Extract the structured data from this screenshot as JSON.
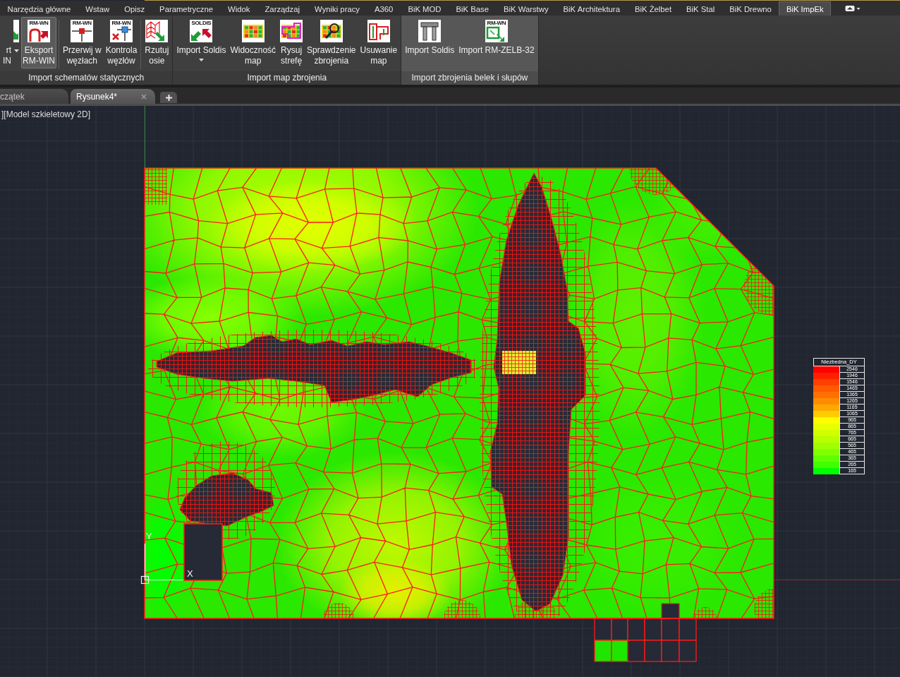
{
  "menu_tabs": [
    {
      "label": "Narzędzia główne",
      "selected": false
    },
    {
      "label": "Wstaw",
      "selected": false
    },
    {
      "label": "Opisz",
      "selected": false
    },
    {
      "label": "Parametryczne",
      "selected": false
    },
    {
      "label": "Widok",
      "selected": false
    },
    {
      "label": "Zarządzaj",
      "selected": false
    },
    {
      "label": "Wyniki pracy",
      "selected": false
    },
    {
      "label": "A360",
      "selected": false
    },
    {
      "label": "BiK MOD",
      "selected": false
    },
    {
      "label": "BiK Base",
      "selected": false
    },
    {
      "label": "BiK Warstwy",
      "selected": false
    },
    {
      "label": "BiK Architektura",
      "selected": false
    },
    {
      "label": "BiK Żelbet",
      "selected": false
    },
    {
      "label": "BiK Stal",
      "selected": false
    },
    {
      "label": "BiK Drewno",
      "selected": false
    },
    {
      "label": "BiK ImpEk",
      "selected": true
    }
  ],
  "ribbon_panels": [
    {
      "title": "Import schematów statycznych",
      "highlighted": false,
      "groups": [
        [
          {
            "label": "rt\nIN",
            "dropdown": true,
            "highlighted": false
          },
          {
            "label": "Eksport\nRM-WIN",
            "icon_text": "RM-WN",
            "dropdown": false,
            "highlighted": true
          }
        ],
        [
          {
            "label": "Przerwij w\nwęzłach",
            "icon_text": "RM-WN",
            "dropdown": false,
            "highlighted": false
          },
          {
            "label": "Kontrola\nwęzłów",
            "icon_text": "RM-WN",
            "dropdown": false,
            "highlighted": false
          }
        ],
        [
          {
            "label": "Rzutuj\nosie",
            "dropdown": false,
            "highlighted": false
          }
        ]
      ]
    },
    {
      "title": "Import map zbrojenia",
      "highlighted": false,
      "groups": [
        [
          {
            "label": "Import Soldis",
            "icon_text": "SOLDIS",
            "dropdown": true,
            "highlighted": false
          },
          {
            "label": "Widoczność\nmap",
            "dropdown": false,
            "highlighted": false
          },
          {
            "label": "Rysuj\nstrefę",
            "dropdown": false,
            "highlighted": false
          },
          {
            "label": "Sprawdzenie\nzbrojenia",
            "dropdown": false,
            "highlighted": false
          },
          {
            "label": "Usuwanie\nmap",
            "dropdown": false,
            "highlighted": false
          }
        ]
      ]
    },
    {
      "title": "Import zbrojenia belek i słupów",
      "highlighted": true,
      "groups": [
        [
          {
            "label": "Import Soldis",
            "dropdown": false,
            "highlighted": false
          },
          {
            "label": "Import RM-ZELB-32",
            "icon_text": "RM-WN",
            "dropdown": false,
            "highlighted": false
          }
        ]
      ]
    }
  ],
  "file_tabs": [
    {
      "label": "czątek",
      "selected": false,
      "closable": false
    },
    {
      "label": "Rysunek4*",
      "selected": true,
      "closable": true
    }
  ],
  "viewport": {
    "label": "][Model szkieletowy 2D]",
    "ucs": {
      "y_label": "Y",
      "x_label": "X"
    },
    "legend": {
      "title": "Niezbedna_DY",
      "items": [
        {
          "value": "2546",
          "color": "#ff0000"
        },
        {
          "value": "1946",
          "color": "#ff2000"
        },
        {
          "value": "1546",
          "color": "#ff4000"
        },
        {
          "value": "1465",
          "color": "#ff5a00"
        },
        {
          "value": "1365",
          "color": "#ff7000"
        },
        {
          "value": "1265",
          "color": "#ff8c00"
        },
        {
          "value": "1165",
          "color": "#ffa800"
        },
        {
          "value": "1065",
          "color": "#ffcc00"
        },
        {
          "value": "965",
          "color": "#ffff00"
        },
        {
          "value": "865",
          "color": "#e8ff00"
        },
        {
          "value": "765",
          "color": "#d0ff00"
        },
        {
          "value": "665",
          "color": "#b8ff00"
        },
        {
          "value": "565",
          "color": "#a0ff00"
        },
        {
          "value": "465",
          "color": "#80ff00"
        },
        {
          "value": "365",
          "color": "#60ff00"
        },
        {
          "value": "265",
          "color": "#40ff00"
        },
        {
          "value": "165",
          "color": "#00ff00"
        }
      ]
    }
  }
}
